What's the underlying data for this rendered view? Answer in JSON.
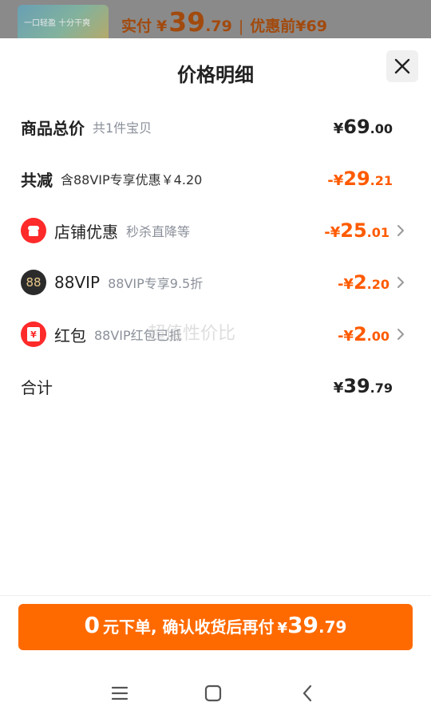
{
  "top": {
    "thumb_text": "一口轻盈 十分干爽",
    "paid_label": "实付",
    "yen": "¥",
    "price_int": "39",
    "price_dec": ".79",
    "separator": "|",
    "before_label": "优惠前¥69"
  },
  "sheet": {
    "title": "价格明细",
    "close_icon": "close-icon"
  },
  "rows": {
    "total": {
      "label": "商品总价",
      "sub": "共1件宝贝",
      "yen": "¥",
      "int": "69",
      "dec": ".00"
    },
    "reduce": {
      "label": "共减",
      "sub": "含88VIP专享优惠￥4.20",
      "yen": "-¥",
      "int": "29",
      "dec": ".21"
    },
    "shop": {
      "label": "店铺优惠",
      "sub": "秒杀直降等",
      "yen": "-¥",
      "int": "25",
      "dec": ".01",
      "icon": "shop-icon"
    },
    "vip": {
      "label": "88VIP",
      "sub": "88VIP专享9.5折",
      "yen": "-¥",
      "int": "2",
      "dec": ".20",
      "icon": "88vip-icon",
      "icon_text": "88"
    },
    "redpack": {
      "label": "红包",
      "sub": "88VIP红包已抵",
      "yen": "-¥",
      "int": "2",
      "dec": ".00",
      "icon": "red-packet-icon",
      "icon_text": "¥"
    },
    "sum": {
      "label": "合计",
      "yen": "¥",
      "int": "39",
      "dec": ".79"
    }
  },
  "watermark": "超值性价比",
  "cta": {
    "zero": "0",
    "text": "元下单, 确认收货后再付",
    "yen": "¥",
    "int": "39",
    "dec": ".79"
  },
  "nav": {
    "menu": "menu-icon",
    "home": "home-icon",
    "back": "back-icon"
  },
  "colors": {
    "accent": "#ff6a00",
    "discount": "#ff5a00",
    "shop_icon": "#ff2a2a",
    "vip_icon": "#2b2b2b"
  }
}
